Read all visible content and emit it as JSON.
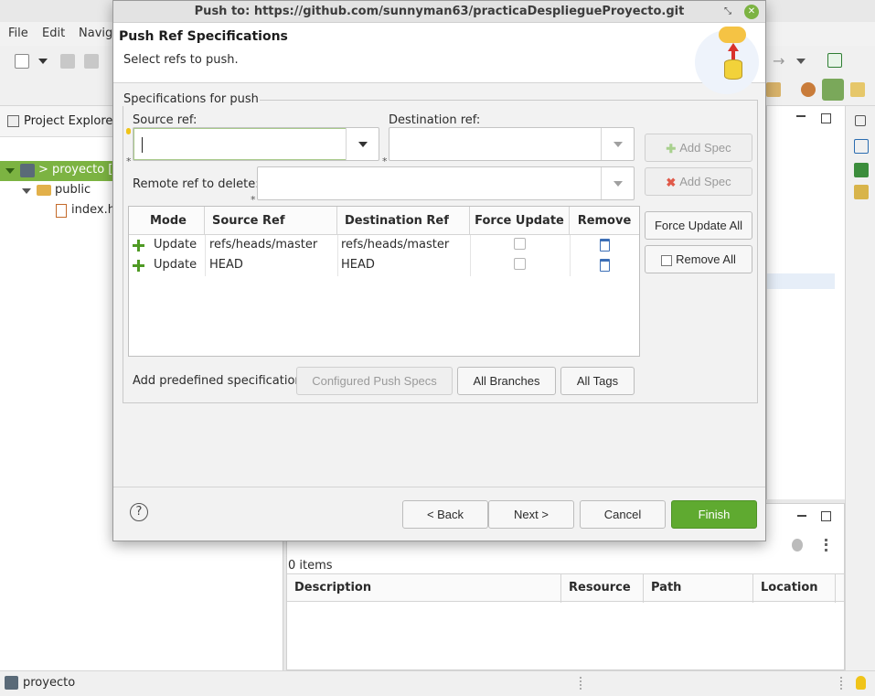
{
  "ide": {
    "menu": [
      "File",
      "Edit",
      "Navig"
    ],
    "project_explorer_title": "Project Explorer",
    "tree": [
      {
        "label": "> proyecto [P"
      },
      {
        "label": "public"
      },
      {
        "label": "index.h"
      }
    ],
    "problems": {
      "count": "0 items",
      "columns": [
        "Description",
        "Resource",
        "Path",
        "Location"
      ]
    },
    "status_project": "proyecto"
  },
  "dialog": {
    "window_title": "Push to: https://github.com/sunnyman63/practicaDespliegueProyecto.git",
    "banner_title": "Push Ref Specifications",
    "banner_message": "Select refs to push.",
    "group_label": "Specifications for push",
    "source_ref_label": "Source ref:",
    "source_ref_value": "",
    "destination_ref_label": "Destination ref:",
    "destination_ref_value": "",
    "remote_delete_label": "Remote ref to delete:",
    "remote_delete_value": "",
    "add_spec_label": "Add Spec",
    "add_spec_delete_label": "Add Spec",
    "force_update_all_label": "Force Update All",
    "remove_all_label": "Remove All",
    "table": {
      "columns": [
        "Mode",
        "Source Ref",
        "Destination Ref",
        "Force Update",
        "Remove"
      ],
      "rows": [
        {
          "mode": "Update",
          "source": "refs/heads/master",
          "destination": "refs/heads/master",
          "force_update": false
        },
        {
          "mode": "Update",
          "source": "HEAD",
          "destination": "HEAD",
          "force_update": false
        }
      ]
    },
    "predefined_label": "Add predefined specification",
    "configured_push_specs_label": "Configured Push Specs",
    "all_branches_label": "All Branches",
    "all_tags_label": "All Tags",
    "help_symbol": "?",
    "back_label": "< Back",
    "next_label": "Next >",
    "cancel_label": "Cancel",
    "finish_label": "Finish"
  },
  "colors": {
    "finish_button": "#5faa30",
    "tree_selection": "#7cb342",
    "add_icon": "#4f9a24",
    "delete_icon": "#e05a4a"
  }
}
